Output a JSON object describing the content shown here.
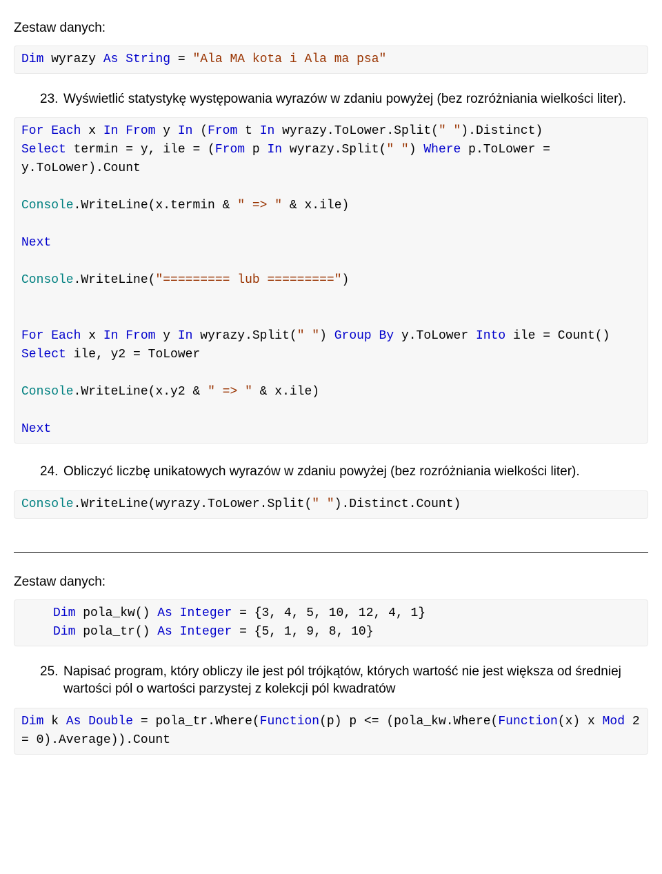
{
  "section1": {
    "heading": "Zestaw danych:",
    "code1_tokens": [
      {
        "t": "Dim ",
        "c": "kw-blue"
      },
      {
        "t": "wyrazy ",
        "c": ""
      },
      {
        "t": "As String ",
        "c": "kw-blue"
      },
      {
        "t": "= ",
        "c": ""
      },
      {
        "t": "\"Ala MA kota i Ala ma psa\"",
        "c": "str-brown"
      }
    ],
    "q23_num": "23.",
    "q23_text": "Wyświetlić statystykę występowania wyrazów w zdaniu powyżej (bez rozróżniania wielkości liter).",
    "code2_tokens": [
      {
        "t": "For Each ",
        "c": "kw-blue"
      },
      {
        "t": "x ",
        "c": ""
      },
      {
        "t": "In From ",
        "c": "kw-blue"
      },
      {
        "t": "y ",
        "c": ""
      },
      {
        "t": "In ",
        "c": "kw-blue"
      },
      {
        "t": "(",
        "c": ""
      },
      {
        "t": "From ",
        "c": "kw-blue"
      },
      {
        "t": "t ",
        "c": ""
      },
      {
        "t": "In ",
        "c": "kw-blue"
      },
      {
        "t": "wyrazy.ToLower.Split(",
        "c": ""
      },
      {
        "t": "\" \"",
        "c": "str-brown"
      },
      {
        "t": ").Distinct)",
        "c": ""
      },
      {
        "t": "\n",
        "c": ""
      },
      {
        "t": "Select ",
        "c": "kw-blue"
      },
      {
        "t": "termin = y, ile = (",
        "c": ""
      },
      {
        "t": "From ",
        "c": "kw-blue"
      },
      {
        "t": "p ",
        "c": ""
      },
      {
        "t": "In ",
        "c": "kw-blue"
      },
      {
        "t": "wyrazy.Split(",
        "c": ""
      },
      {
        "t": "\" \"",
        "c": "str-brown"
      },
      {
        "t": ") ",
        "c": ""
      },
      {
        "t": "Where ",
        "c": "kw-blue"
      },
      {
        "t": "p.ToLower = y.ToLower).Count",
        "c": ""
      },
      {
        "t": "\n\n",
        "c": ""
      },
      {
        "t": "Console",
        "c": "typ-teal"
      },
      {
        "t": ".WriteLine(x.termin & ",
        "c": ""
      },
      {
        "t": "\" => \"",
        "c": "str-brown"
      },
      {
        "t": " & x.ile)",
        "c": ""
      },
      {
        "t": "\n\n",
        "c": ""
      },
      {
        "t": "Next",
        "c": "kw-blue"
      },
      {
        "t": "\n\n",
        "c": ""
      },
      {
        "t": "Console",
        "c": "typ-teal"
      },
      {
        "t": ".WriteLine(",
        "c": ""
      },
      {
        "t": "\"========= lub =========\"",
        "c": "str-brown"
      },
      {
        "t": ")",
        "c": ""
      },
      {
        "t": "\n\n\n",
        "c": ""
      },
      {
        "t": "For Each ",
        "c": "kw-blue"
      },
      {
        "t": "x ",
        "c": ""
      },
      {
        "t": "In From ",
        "c": "kw-blue"
      },
      {
        "t": "y ",
        "c": ""
      },
      {
        "t": "In ",
        "c": "kw-blue"
      },
      {
        "t": "wyrazy.Split(",
        "c": ""
      },
      {
        "t": "\" \"",
        "c": "str-brown"
      },
      {
        "t": ") ",
        "c": ""
      },
      {
        "t": "Group By ",
        "c": "kw-blue"
      },
      {
        "t": "y.ToLower ",
        "c": ""
      },
      {
        "t": "Into ",
        "c": "kw-blue"
      },
      {
        "t": "ile = Count() ",
        "c": ""
      },
      {
        "t": "Select ",
        "c": "kw-blue"
      },
      {
        "t": "ile, y2 = ToLower",
        "c": ""
      },
      {
        "t": "\n\n",
        "c": ""
      },
      {
        "t": "Console",
        "c": "typ-teal"
      },
      {
        "t": ".WriteLine(x.y2 & ",
        "c": ""
      },
      {
        "t": "\" => \"",
        "c": "str-brown"
      },
      {
        "t": " & x.ile)",
        "c": ""
      },
      {
        "t": "\n\n",
        "c": ""
      },
      {
        "t": "Next",
        "c": "kw-blue"
      }
    ],
    "q24_num": "24.",
    "q24_text": "Obliczyć liczbę unikatowych wyrazów w zdaniu powyżej (bez rozróżniania wielkości liter).",
    "code3_tokens": [
      {
        "t": "Console",
        "c": "typ-teal"
      },
      {
        "t": ".WriteLine(wyrazy.ToLower.Split(",
        "c": ""
      },
      {
        "t": "\" \"",
        "c": "str-brown"
      },
      {
        "t": ").Distinct.Count)",
        "c": ""
      }
    ]
  },
  "section2": {
    "heading": "Zestaw danych:",
    "code4_tokens": [
      {
        "t": "Dim ",
        "c": "kw-blue"
      },
      {
        "t": "pola_kw() ",
        "c": ""
      },
      {
        "t": "As Integer ",
        "c": "kw-blue"
      },
      {
        "t": "= {3, 4, 5, 10, 12, 4, 1}",
        "c": ""
      },
      {
        "t": "\n",
        "c": ""
      },
      {
        "t": "Dim ",
        "c": "kw-blue"
      },
      {
        "t": "pola_tr() ",
        "c": ""
      },
      {
        "t": "As Integer ",
        "c": "kw-blue"
      },
      {
        "t": "= {5, 1, 9, 8, 10}",
        "c": ""
      }
    ],
    "q25_num": "25.",
    "q25_text": "Napisać program, który obliczy ile jest pól trójkątów, których wartość nie jest większa od średniej wartości pól o wartości parzystej z kolekcji pól kwadratów",
    "code5_tokens": [
      {
        "t": "Dim ",
        "c": "kw-blue"
      },
      {
        "t": "k ",
        "c": ""
      },
      {
        "t": "As Double ",
        "c": "kw-blue"
      },
      {
        "t": "= pola_tr.Where(",
        "c": ""
      },
      {
        "t": "Function",
        "c": "kw-blue"
      },
      {
        "t": "(p) p <= (pola_kw.Where(",
        "c": ""
      },
      {
        "t": "Function",
        "c": "kw-blue"
      },
      {
        "t": "(x) x ",
        "c": ""
      },
      {
        "t": "Mod ",
        "c": "kw-blue"
      },
      {
        "t": "2 = 0).Average)).Count",
        "c": ""
      }
    ]
  }
}
